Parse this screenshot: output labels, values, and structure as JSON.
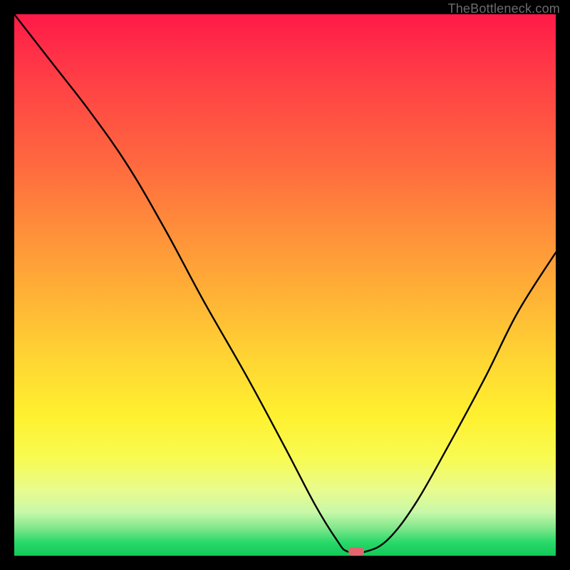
{
  "watermark": {
    "text": "TheBottleneck.com"
  },
  "marker": {
    "x_frac": 0.632,
    "y_frac": 0.992,
    "color": "#e2646f"
  },
  "chart_data": {
    "type": "line",
    "title": "",
    "xlabel": "",
    "ylabel": "",
    "xlim": [
      0,
      1
    ],
    "ylim": [
      0,
      1
    ],
    "series": [
      {
        "name": "bottleneck-curve",
        "x": [
          0.0,
          0.07,
          0.14,
          0.21,
          0.28,
          0.35,
          0.43,
          0.5,
          0.555,
          0.595,
          0.615,
          0.65,
          0.69,
          0.74,
          0.8,
          0.87,
          0.93,
          1.0
        ],
        "y": [
          1.0,
          0.91,
          0.82,
          0.72,
          0.6,
          0.47,
          0.33,
          0.2,
          0.095,
          0.03,
          0.008,
          0.008,
          0.03,
          0.095,
          0.2,
          0.33,
          0.45,
          0.56
        ]
      }
    ],
    "background_gradient": {
      "direction": "top-to-bottom",
      "stops": [
        {
          "pct": 0,
          "color": "#ff1a49"
        },
        {
          "pct": 12,
          "color": "#ff3f46"
        },
        {
          "pct": 28,
          "color": "#ff6a3f"
        },
        {
          "pct": 40,
          "color": "#ff8f3a"
        },
        {
          "pct": 52,
          "color": "#ffb236"
        },
        {
          "pct": 64,
          "color": "#ffd633"
        },
        {
          "pct": 74,
          "color": "#fff02f"
        },
        {
          "pct": 82,
          "color": "#f8fb52"
        },
        {
          "pct": 88,
          "color": "#e8fb8e"
        },
        {
          "pct": 92,
          "color": "#c7f8a8"
        },
        {
          "pct": 95,
          "color": "#7de68a"
        },
        {
          "pct": 97.5,
          "color": "#2ad96a"
        },
        {
          "pct": 100,
          "color": "#11c957"
        }
      ]
    }
  }
}
